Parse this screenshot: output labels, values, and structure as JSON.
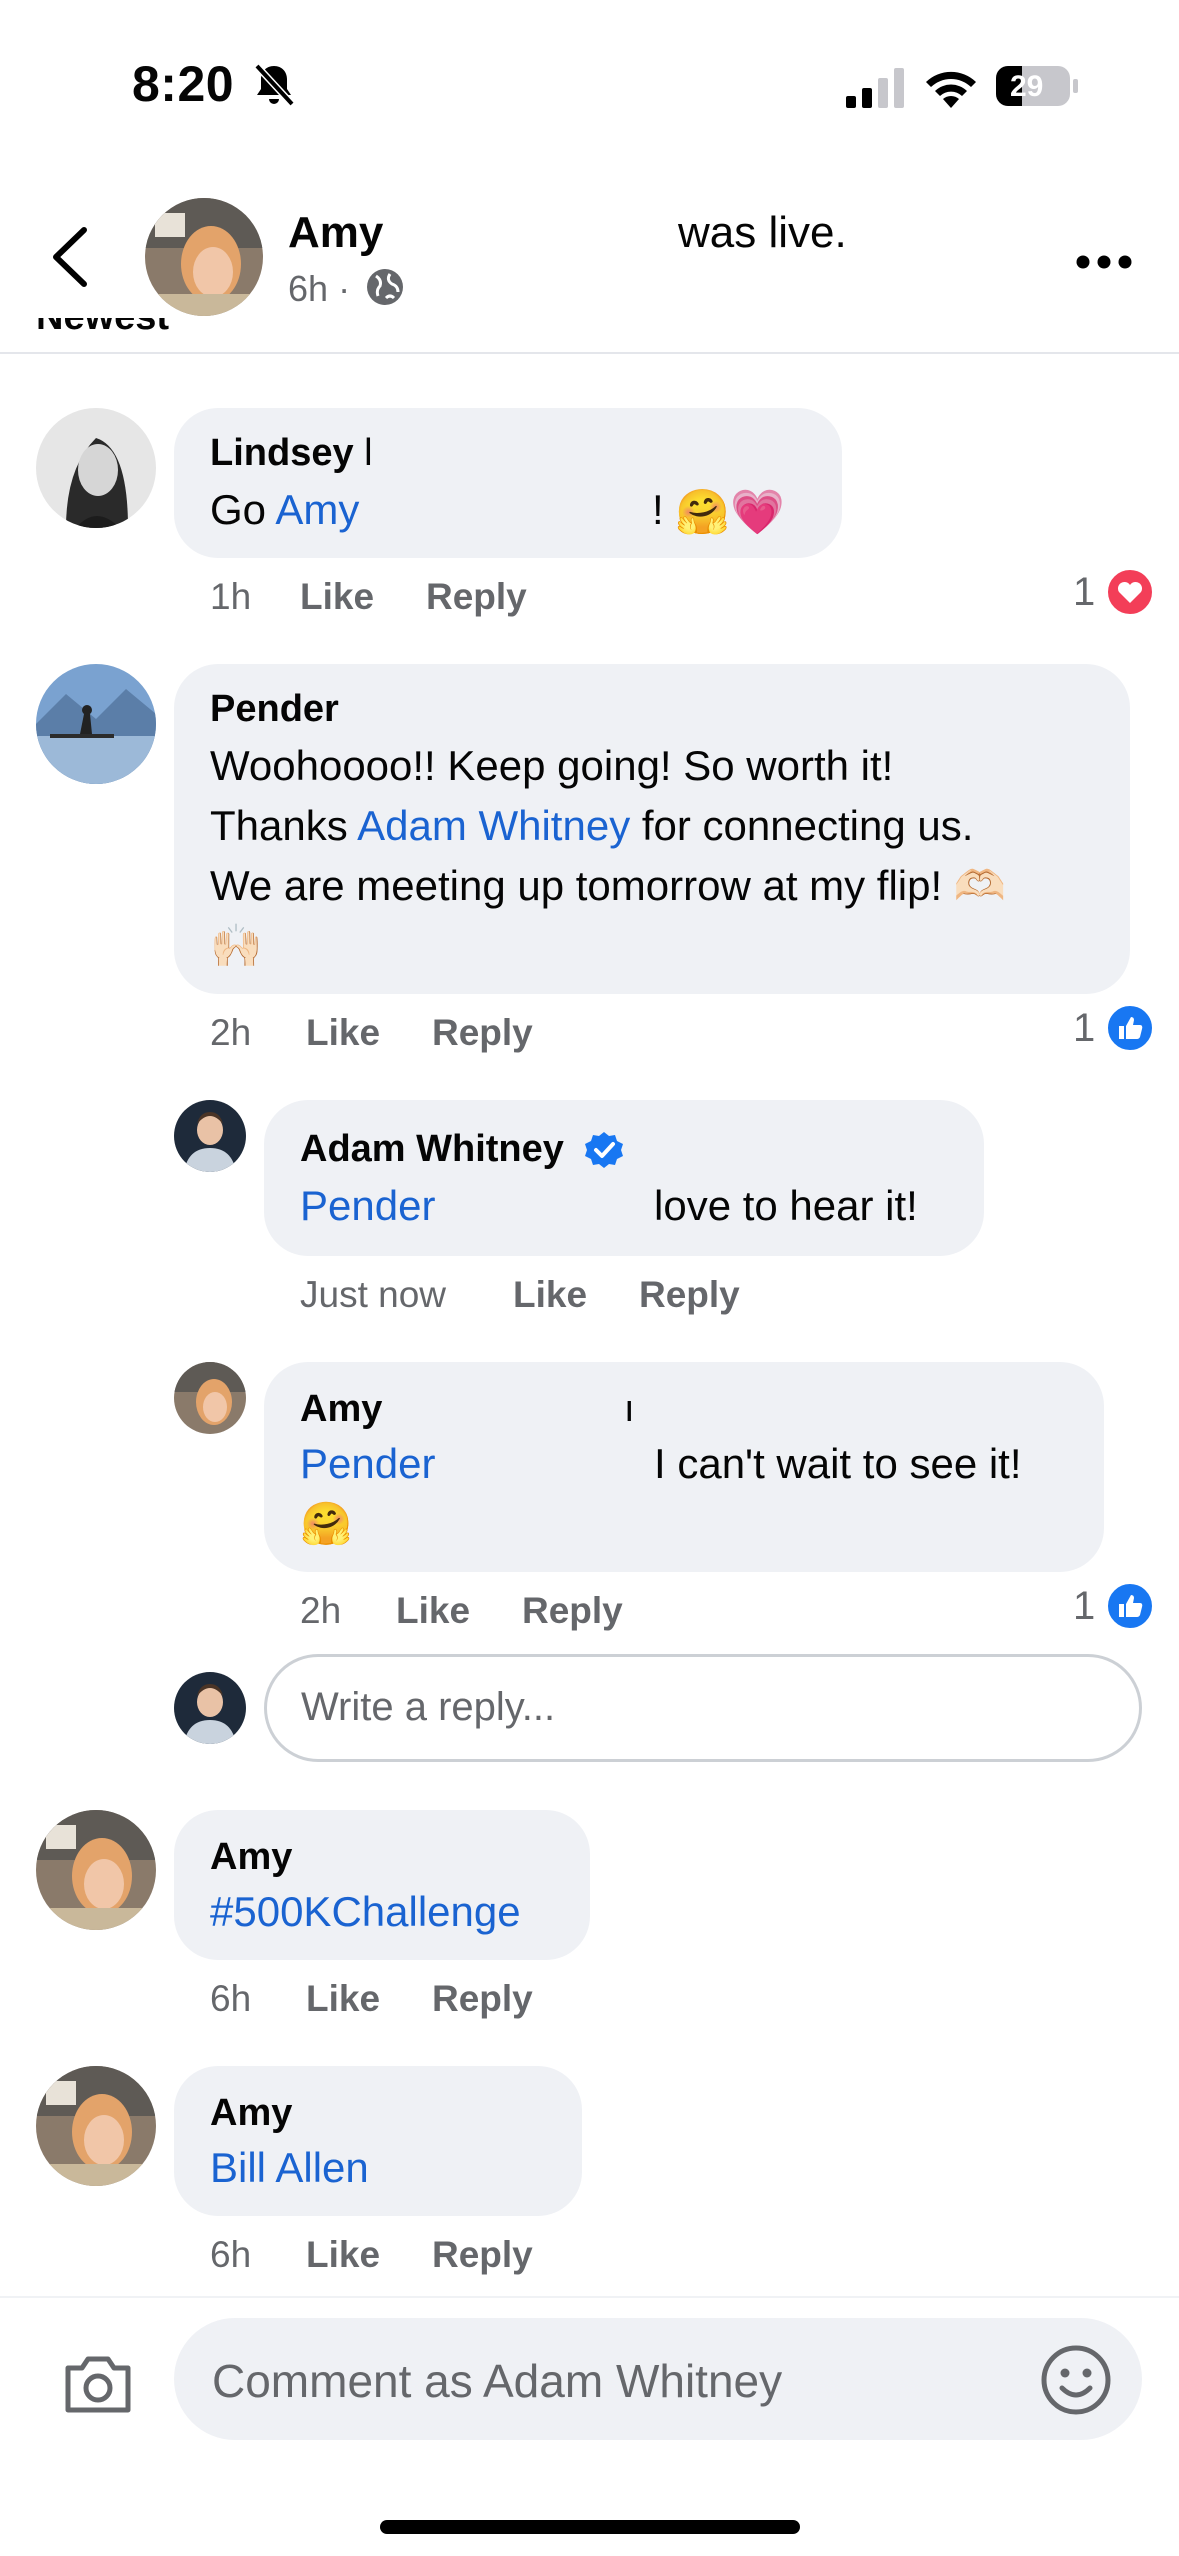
{
  "status_bar": {
    "time": "8:20",
    "battery": "29"
  },
  "post": {
    "author": "Amy",
    "action": "was live.",
    "time": "6h",
    "separator": "·"
  },
  "partial_heading": "Newest",
  "comments": [
    {
      "name": "Lindsey",
      "name_trail": "l",
      "text_prefix": "Go ",
      "mention": "Amy",
      "text_suffix": "!",
      "emojis": "🤗💗",
      "time": "1h",
      "like": "Like",
      "reply": "Reply",
      "reaction_count": "1",
      "reaction": "heart"
    },
    {
      "name": "Pender",
      "line1": "Woohoooo!! Keep going! So worth it!",
      "line2_prefix": "Thanks ",
      "line2_mention": "Adam Whitney",
      "line2_suffix": " for connecting us.",
      "line3": "We are meeting up tomorrow at my flip! 🫶🏻",
      "line4": "🙌🏻",
      "time": "2h",
      "like": "Like",
      "reply": "Reply",
      "reaction_count": "1",
      "reaction": "like"
    }
  ],
  "replies": [
    {
      "name": "Adam Whitney",
      "verified": true,
      "mention": "Pender",
      "text": "love to hear it!",
      "time": "Just now",
      "like": "Like",
      "reply": "Reply"
    },
    {
      "name": "Amy",
      "name_trail": "ı",
      "mention": "Pender",
      "text": "I can't wait to see it!",
      "emoji": "🤗",
      "time": "2h",
      "like": "Like",
      "reply": "Reply",
      "reaction_count": "1",
      "reaction": "like"
    }
  ],
  "reply_input": {
    "placeholder": "Write a reply..."
  },
  "later_comments": [
    {
      "name": "Amy",
      "text": "#500KChallenge",
      "time": "6h",
      "like": "Like",
      "reply": "Reply"
    },
    {
      "name": "Amy",
      "text": "Bill Allen",
      "time": "6h",
      "like": "Like",
      "reply": "Reply"
    }
  ],
  "composer": {
    "placeholder": "Comment as Adam Whitney"
  },
  "colors": {
    "link": "#1a63d1",
    "like_blue": "#1877f2",
    "heart_red": "#f33e58",
    "bubble": "#eff1f5"
  }
}
